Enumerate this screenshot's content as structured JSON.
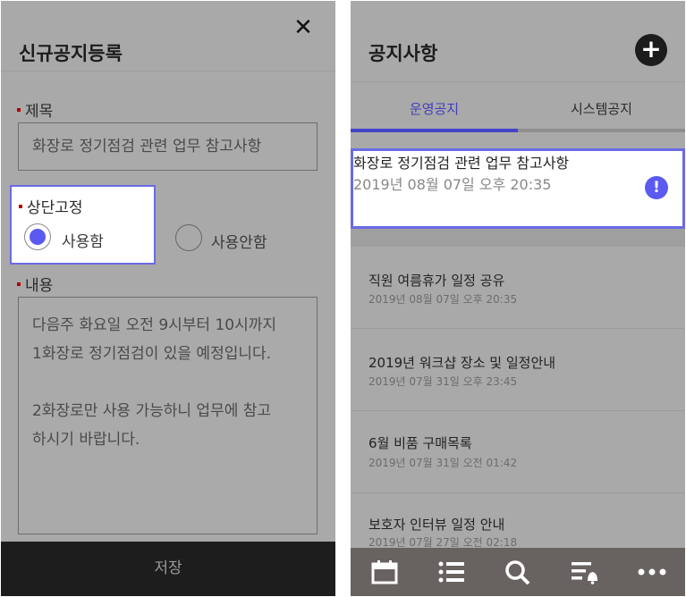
{
  "left": {
    "title": "신규공지등록",
    "close_icon": "close-icon",
    "title_label": "제목",
    "title_value": "화장로 정기점검 관련 업무 참고사항",
    "pin_label": "상단고정",
    "radio_on_label": "사용함",
    "radio_off_label": "사용안함",
    "content_label": "내용",
    "content_value": "다음주 화요일 오전 9시부터 10시까지\n1화장로 정기점검이 있을 예정입니다.\n\n2화장로만 사용 가능하니 업무에 참고\n하시기 바랍니다.",
    "save_label": "저장"
  },
  "right": {
    "title": "공지사항",
    "add_icon": "plus-icon",
    "tabs": [
      {
        "label": "운영공지",
        "active": true
      },
      {
        "label": "시스템공지",
        "active": false
      }
    ],
    "pinned": {
      "title": "화장로 정기점검 관련 업무 참고사항",
      "date": "2019년 08월 07일 오후 20:35",
      "icon": "exclamation-icon"
    },
    "notices": [
      {
        "title": "직원 여름휴가 일정 공유",
        "date": "2019년 08월 07일 오후 20:35"
      },
      {
        "title": "2019년 워크샵 장소 및 일정안내",
        "date": "2019년 07월 31일 오후 23:45"
      },
      {
        "title": "6월 비품 구매목록",
        "date": "2019년 07월 31일 오전 01:42"
      },
      {
        "title": "보호자 인터뷰 일정 안내",
        "date": "2019년 07월 27일 오전 02:18"
      }
    ],
    "nav_icons": [
      "calendar-icon",
      "list-icon",
      "search-icon",
      "notification-list-icon",
      "more-icon"
    ]
  },
  "colors": {
    "accent": "#5a5af0",
    "highlight_border": "#6a6ae6",
    "overlay_gray": "#a9a9a9",
    "nav_bg": "#686260"
  }
}
